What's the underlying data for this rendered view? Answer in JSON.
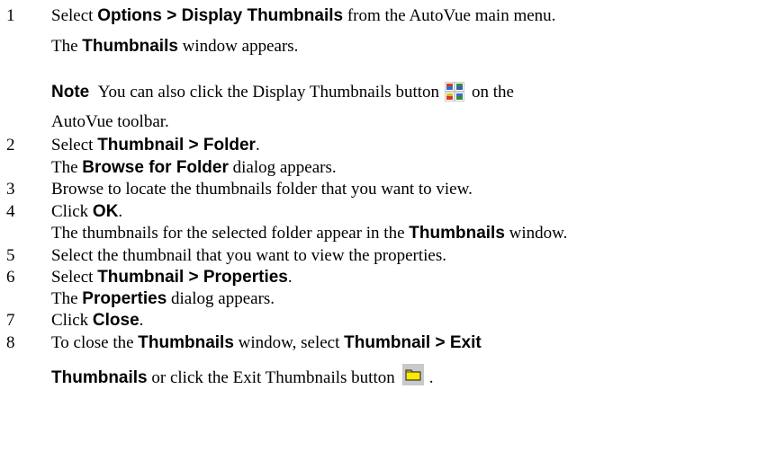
{
  "steps": [
    {
      "number": "1",
      "lines": [
        [
          "Select ",
          "Options > Display Thumbnails",
          " from the AutoVue main menu."
        ],
        [
          "The ",
          "Thumbnails",
          " window appears."
        ]
      ],
      "note": {
        "label": "Note",
        "text_before": "You can also click the Display Thumbnails button",
        "text_after": "on the",
        "text_line2": "AutoVue toolbar.",
        "icon": "display-thumbnails-icon"
      }
    },
    {
      "number": "2",
      "lines": [
        [
          "Select ",
          "Thumbnail > Folder",
          "."
        ],
        [
          "The ",
          "Browse for Folder",
          " dialog appears."
        ]
      ]
    },
    {
      "number": "3",
      "lines": [
        [
          "Browse to locate the thumbnails folder that you want to view."
        ]
      ]
    },
    {
      "number": "4",
      "lines": [
        [
          "Click ",
          "OK",
          "."
        ],
        [
          "The thumbnails for the selected folder appear in the ",
          "Thumbnails",
          " window."
        ]
      ]
    },
    {
      "number": "5",
      "lines": [
        [
          "Select the thumbnail that you want to view the properties."
        ]
      ]
    },
    {
      "number": "6",
      "lines": [
        [
          "Select ",
          "Thumbnail > Properties",
          "."
        ],
        [
          "The ",
          "Properties",
          " dialog appears."
        ]
      ]
    },
    {
      "number": "7",
      "lines": [
        [
          "Click ",
          "Close",
          "."
        ]
      ]
    },
    {
      "number": "8",
      "lines": [
        [
          "To close the ",
          "Thumbnails",
          " window, select ",
          "Thumbnail > Exit"
        ],
        [
          "Thumbnails",
          " or click the Exit Thumbnails button",
          "",
          "."
        ]
      ],
      "icon": "exit-thumbnails-icon"
    }
  ]
}
